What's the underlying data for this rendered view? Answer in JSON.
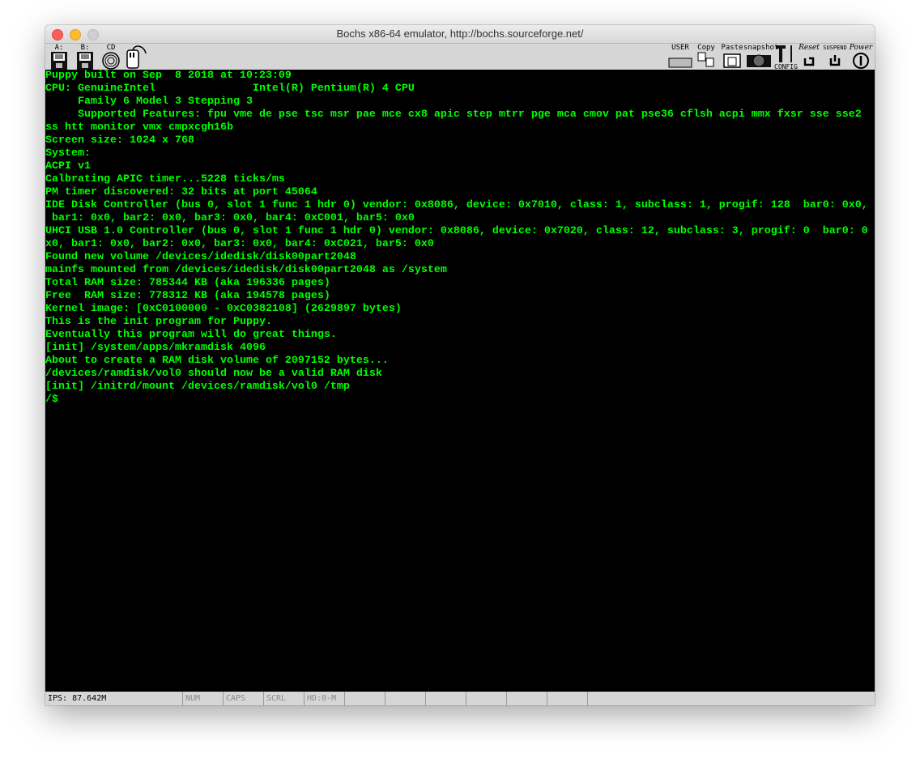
{
  "window": {
    "title": "Bochs x86-64 emulator, http://bochs.sourceforge.net/"
  },
  "toolbar": {
    "floppy_a": "A:",
    "floppy_b": "B:",
    "cdrom": "CD",
    "user": "USER",
    "copy": "Copy",
    "paste": "Paste",
    "snapshot": "snapshot",
    "config": "CONFIG",
    "reset": "Reset",
    "suspend": "SUSPEND",
    "power": "Power"
  },
  "terminal": {
    "lines": [
      "Puppy built on Sep  8 2018 at 10:23:09",
      "CPU: GenuineIntel               Intel(R) Pentium(R) 4 CPU",
      "     Family 6 Model 3 Stepping 3",
      "     Supported Features: fpu vme de pse tsc msr pae mce cx8 apic step mtrr pge mca cmov pat pse36 cflsh acpi mmx fxsr sse sse2",
      "ss htt monitor vmx cmpxcgh16b",
      "Screen size: 1024 x 768",
      "System:",
      "ACPI v1",
      "Calbrating APIC timer...5228 ticks/ms",
      "PM timer discovered: 32 bits at port 45064",
      "IDE Disk Controller (bus 0, slot 1 func 1 hdr 0) vendor: 0x8086, device: 0x7010, class: 1, subclass: 1, progif: 128  bar0: 0x0,",
      " bar1: 0x0, bar2: 0x0, bar3: 0x0, bar4: 0xC001, bar5: 0x0",
      "UHCI USB 1.0 Controller (bus 0, slot 1 func 1 hdr 0) vendor: 0x8086, device: 0x7020, class: 12, subclass: 3, progif: 0  bar0: 0",
      "x0, bar1: 0x0, bar2: 0x0, bar3: 0x0, bar4: 0xC021, bar5: 0x0",
      "Found new volume /devices/idedisk/disk00part2048",
      "mainfs mounted from /devices/idedisk/disk00part2048 as /system",
      "Total RAM size: 785344 KB (aka 196336 pages)",
      "Free  RAM size: 778312 KB (aka 194578 pages)",
      "Kernel image: [0xC0100000 - 0xC0382108] (2629897 bytes)",
      "This is the init program for Puppy.",
      "Eventually this program will do great things.",
      "[init] /system/apps/mkramdisk 4096",
      "About to create a RAM disk volume of 2097152 bytes...",
      "/devices/ramdisk/vol0 should now be a valid RAM disk",
      "[init] /initrd/mount /devices/ramdisk/vol0 /tmp",
      "/$"
    ]
  },
  "statusbar": {
    "ips": "IPS: 87.642M",
    "num": "NUM",
    "caps": "CAPS",
    "scrl": "SCRL",
    "hd": "HD:0-M"
  }
}
